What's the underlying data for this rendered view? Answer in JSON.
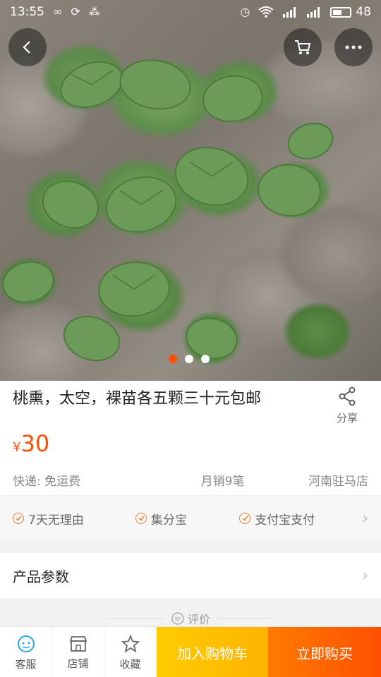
{
  "status_bar": {
    "time": "13:55",
    "battery": "48",
    "left_icons": [
      "infinity-icon",
      "sync-icon",
      "app-icon"
    ],
    "right_icons": [
      "alarm-icon",
      "wifi-icon",
      "signal-icon",
      "signal-4g-icon",
      "battery-icon"
    ]
  },
  "nav": {
    "back_icon": "chevron-left-icon",
    "cart_icon": "cart-icon",
    "more_icon": "more-dots-icon"
  },
  "gallery": {
    "total": 3,
    "active": 1
  },
  "product": {
    "title": "桃熏，太空，裸苗各五颗三十元包邮",
    "share_label": "分享",
    "price_currency": "¥",
    "price": "30",
    "shipping": "快递: 免运费",
    "monthly_sales": "月销9笔",
    "location": "河南驻马店"
  },
  "services": [
    {
      "label": "7天无理由"
    },
    {
      "label": "集分宝"
    },
    {
      "label": "支付宝支付"
    }
  ],
  "params": {
    "label": "产品参数"
  },
  "review": {
    "label": "评价"
  },
  "bottom_bar": {
    "service_label": "客服",
    "shop_label": "店铺",
    "favorite_label": "收藏",
    "add_cart_label": "加入购物车",
    "buy_now_label": "立即购买"
  },
  "colors": {
    "accent": "#ff5000",
    "add_cart": "#ffb400",
    "buy_now": "#ff5000",
    "service_icon": "#2aa7e8"
  }
}
